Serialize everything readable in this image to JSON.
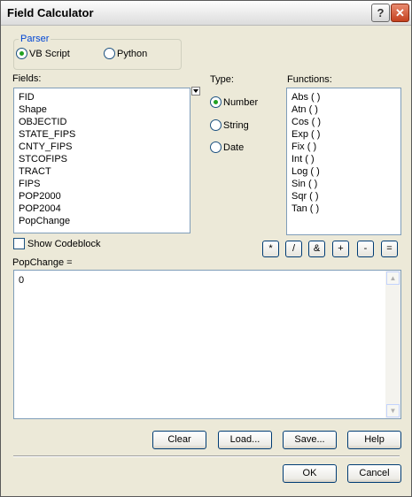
{
  "window": {
    "title": "Field Calculator",
    "help_glyph": "?",
    "close_glyph": "✕"
  },
  "parser": {
    "legend": "Parser",
    "options": [
      {
        "label": "VB Script",
        "selected": true
      },
      {
        "label": "Python",
        "selected": false
      }
    ]
  },
  "fields": {
    "label": "Fields:",
    "items": [
      "FID",
      "Shape",
      "OBJECTID",
      "STATE_FIPS",
      "CNTY_FIPS",
      "STCOFIPS",
      "TRACT",
      "FIPS",
      "POP2000",
      "POP2004",
      "PopChange"
    ]
  },
  "type": {
    "label": "Type:",
    "options": [
      {
        "label": "Number",
        "selected": true
      },
      {
        "label": "String",
        "selected": false
      },
      {
        "label": "Date",
        "selected": false
      }
    ]
  },
  "functions": {
    "label": "Functions:",
    "items": [
      "Abs ( )",
      "Atn ( )",
      "Cos ( )",
      "Exp ( )",
      "Fix ( )",
      "Int ( )",
      "Log ( )",
      "Sin ( )",
      "Sqr ( )",
      "Tan ( )"
    ]
  },
  "codeblock": {
    "label": "Show Codeblock",
    "checked": false
  },
  "operators": [
    "*",
    "/",
    "&",
    "+",
    "-",
    "="
  ],
  "expression": {
    "label": "PopChange =",
    "value": "0"
  },
  "actions": {
    "clear": "Clear",
    "load": "Load...",
    "save": "Save...",
    "help": "Help"
  },
  "footer": {
    "ok": "OK",
    "cancel": "Cancel"
  }
}
